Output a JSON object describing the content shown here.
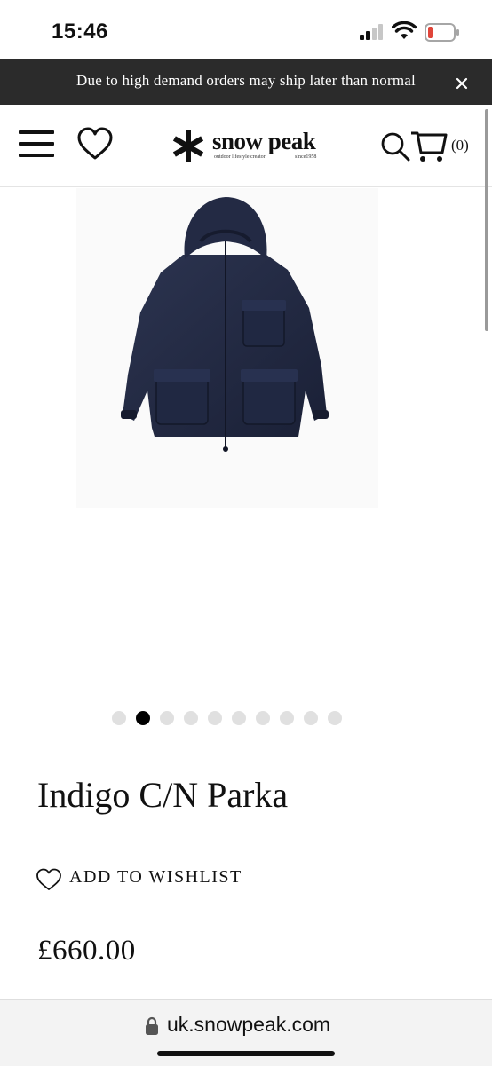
{
  "status_bar": {
    "time": "15:46",
    "icons": [
      "cellular-signal-icon",
      "wifi-icon",
      "battery-low-icon"
    ],
    "battery_color": "#e0453a"
  },
  "banner": {
    "text": "Due to high demand orders may ship later than normal",
    "close_icon": "close-icon",
    "background": "#2b2b2b"
  },
  "header": {
    "logo": {
      "wordmark": "snow peak",
      "tagline": "outdoor lifestyle creator",
      "since": "since1958"
    },
    "icons": [
      "menu-icon",
      "heart-icon",
      "search-icon",
      "cart-icon"
    ],
    "cart_count": "(0)"
  },
  "product": {
    "image_alt": "navy parka",
    "carousel": {
      "total": 10,
      "active_index": 1
    },
    "title": "Indigo C/N Parka",
    "wishlist_label": "ADD TO WISHLIST",
    "price": "£660.00"
  },
  "browser": {
    "url": "uk.snowpeak.com",
    "lock_icon": "lock-icon"
  }
}
